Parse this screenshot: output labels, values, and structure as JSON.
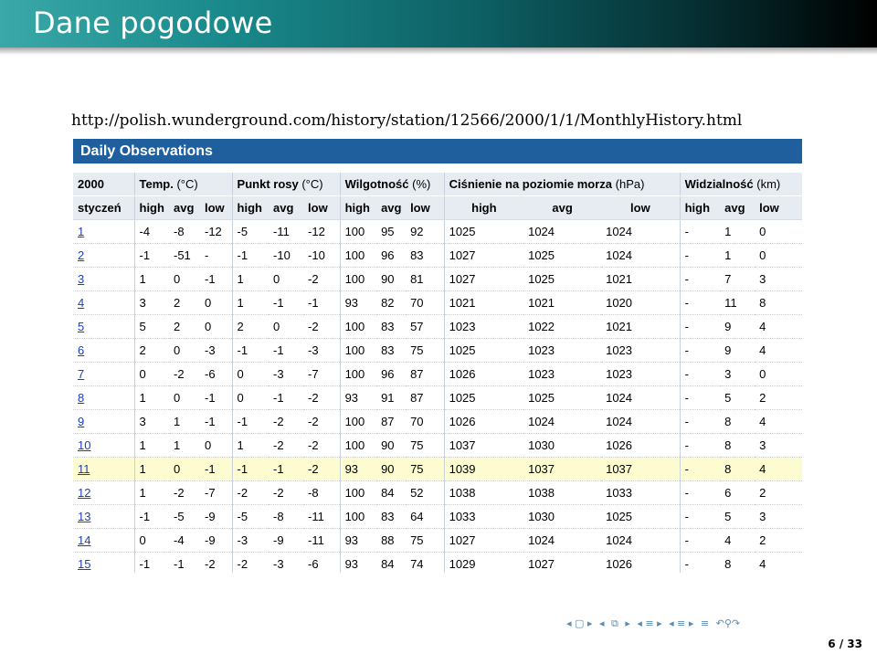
{
  "slide": {
    "title": "Dane pogodowe",
    "url": "http://polish.wunderground.com/history/station/12566/2000/1/1/MonthlyHistory.html",
    "page_number": "6 / 33"
  },
  "panel": {
    "title": "Daily Observations"
  },
  "table": {
    "groups": [
      {
        "label": "2000",
        "unit": ""
      },
      {
        "label": "Temp.",
        "unit": "(°C)"
      },
      {
        "label": "Punkt rosy",
        "unit": "(°C)"
      },
      {
        "label": "Wilgotność",
        "unit": "(%)"
      },
      {
        "label": "Ciśnienie na poziomie morza",
        "unit": "(hPa)"
      },
      {
        "label": "Widzialność",
        "unit": "(km)"
      }
    ],
    "month_label": "styczeń",
    "subheaders": [
      "high",
      "avg",
      "low"
    ],
    "rows": [
      {
        "day": "1",
        "temp": [
          "-4",
          "-8",
          "-12"
        ],
        "dew": [
          "-5",
          "-11",
          "-12"
        ],
        "hum": [
          "100",
          "95",
          "92"
        ],
        "press": [
          "1025",
          "1024",
          "1024"
        ],
        "vis": [
          "-",
          "1",
          "0"
        ]
      },
      {
        "day": "2",
        "temp": [
          "-1",
          "-51",
          "-"
        ],
        "dew": [
          "-1",
          "-10",
          "-10"
        ],
        "hum": [
          "100",
          "96",
          "83"
        ],
        "press": [
          "1027",
          "1025",
          "1024"
        ],
        "vis": [
          "-",
          "1",
          "0"
        ]
      },
      {
        "day": "3",
        "temp": [
          "1",
          "0",
          "-1"
        ],
        "dew": [
          "1",
          "0",
          "-2"
        ],
        "hum": [
          "100",
          "90",
          "81"
        ],
        "press": [
          "1027",
          "1025",
          "1021"
        ],
        "vis": [
          "-",
          "7",
          "3"
        ]
      },
      {
        "day": "4",
        "temp": [
          "3",
          "2",
          "0"
        ],
        "dew": [
          "1",
          "-1",
          "-1"
        ],
        "hum": [
          "93",
          "82",
          "70"
        ],
        "press": [
          "1021",
          "1021",
          "1020"
        ],
        "vis": [
          "-",
          "11",
          "8"
        ]
      },
      {
        "day": "5",
        "temp": [
          "5",
          "2",
          "0"
        ],
        "dew": [
          "2",
          "0",
          "-2"
        ],
        "hum": [
          "100",
          "83",
          "57"
        ],
        "press": [
          "1023",
          "1022",
          "1021"
        ],
        "vis": [
          "-",
          "9",
          "4"
        ]
      },
      {
        "day": "6",
        "temp": [
          "2",
          "0",
          "-3"
        ],
        "dew": [
          "-1",
          "-1",
          "-3"
        ],
        "hum": [
          "100",
          "83",
          "75"
        ],
        "press": [
          "1025",
          "1023",
          "1023"
        ],
        "vis": [
          "-",
          "9",
          "4"
        ]
      },
      {
        "day": "7",
        "temp": [
          "0",
          "-2",
          "-6"
        ],
        "dew": [
          "0",
          "-3",
          "-7"
        ],
        "hum": [
          "100",
          "96",
          "87"
        ],
        "press": [
          "1026",
          "1023",
          "1023"
        ],
        "vis": [
          "-",
          "3",
          "0"
        ]
      },
      {
        "day": "8",
        "temp": [
          "1",
          "0",
          "-1"
        ],
        "dew": [
          "0",
          "-1",
          "-2"
        ],
        "hum": [
          "93",
          "91",
          "87"
        ],
        "press": [
          "1025",
          "1025",
          "1024"
        ],
        "vis": [
          "-",
          "5",
          "2"
        ]
      },
      {
        "day": "9",
        "temp": [
          "3",
          "1",
          "-1"
        ],
        "dew": [
          "-1",
          "-2",
          "-2"
        ],
        "hum": [
          "100",
          "87",
          "70"
        ],
        "press": [
          "1026",
          "1024",
          "1024"
        ],
        "vis": [
          "-",
          "8",
          "4"
        ]
      },
      {
        "day": "10",
        "temp": [
          "1",
          "1",
          "0"
        ],
        "dew": [
          "1",
          "-2",
          "-2"
        ],
        "hum": [
          "100",
          "90",
          "75"
        ],
        "press": [
          "1037",
          "1030",
          "1026"
        ],
        "vis": [
          "-",
          "8",
          "3"
        ]
      },
      {
        "day": "11",
        "temp": [
          "1",
          "0",
          "-1"
        ],
        "dew": [
          "-1",
          "-1",
          "-2"
        ],
        "hum": [
          "93",
          "90",
          "75"
        ],
        "press": [
          "1039",
          "1037",
          "1037"
        ],
        "vis": [
          "-",
          "8",
          "4"
        ],
        "highlight": true
      },
      {
        "day": "12",
        "temp": [
          "1",
          "-2",
          "-7"
        ],
        "dew": [
          "-2",
          "-2",
          "-8"
        ],
        "hum": [
          "100",
          "84",
          "52"
        ],
        "press": [
          "1038",
          "1038",
          "1033"
        ],
        "vis": [
          "-",
          "6",
          "2"
        ]
      },
      {
        "day": "13",
        "temp": [
          "-1",
          "-5",
          "-9"
        ],
        "dew": [
          "-5",
          "-8",
          "-11"
        ],
        "hum": [
          "100",
          "83",
          "64"
        ],
        "press": [
          "1033",
          "1030",
          "1025"
        ],
        "vis": [
          "-",
          "5",
          "3"
        ]
      },
      {
        "day": "14",
        "temp": [
          "0",
          "-4",
          "-9"
        ],
        "dew": [
          "-3",
          "-9",
          "-11"
        ],
        "hum": [
          "93",
          "88",
          "75"
        ],
        "press": [
          "1027",
          "1024",
          "1024"
        ],
        "vis": [
          "-",
          "4",
          "2"
        ]
      },
      {
        "day": "15",
        "temp": [
          "-1",
          "-1",
          "-2"
        ],
        "dew": [
          "-2",
          "-3",
          "-6"
        ],
        "hum": [
          "93",
          "84",
          "74"
        ],
        "press": [
          "1029",
          "1027",
          "1026"
        ],
        "vis": [
          "-",
          "8",
          "4"
        ]
      }
    ]
  },
  "navigation": {
    "icons": [
      "nav-first-icon",
      "nav-prev-frame-icon",
      "nav-next-frame-icon",
      "nav-prev-subsection-icon",
      "nav-next-subsection-icon",
      "nav-prev-section-icon",
      "nav-next-section-icon",
      "nav-align-icon",
      "nav-search-icon"
    ],
    "color": "#5b8bb0"
  },
  "colors": {
    "title_bar": "#1a8a8c",
    "panel_header": "#1f5f9e",
    "header_row": "#e7ecf2",
    "highlight_row": "#fdfbd0",
    "link": "#1a3fbf"
  }
}
